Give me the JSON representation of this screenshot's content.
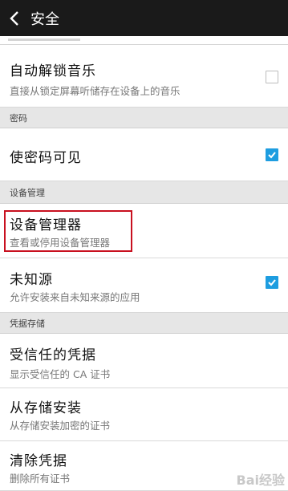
{
  "header": {
    "title": "安全"
  },
  "rows": {
    "auto_unlock_music": {
      "title": "自动解锁音乐",
      "subtitle": "直接从锁定屏幕听储存在设备上的音乐",
      "checked": false
    },
    "show_password": {
      "title": "使密码可见",
      "checked": true
    },
    "device_admins": {
      "title": "设备管理器",
      "subtitle": "查看或停用设备管理器"
    },
    "unknown_sources": {
      "title": "未知源",
      "subtitle": "允许安装来自未知来源的应用",
      "checked": true
    },
    "trusted_credentials": {
      "title": "受信任的凭据",
      "subtitle": "显示受信任的 CA 证书"
    },
    "install_from_storage": {
      "title": "从存储安装",
      "subtitle": "从存储安装加密的证书"
    },
    "clear_credentials": {
      "title": "清除凭据",
      "subtitle": "删除所有证书"
    }
  },
  "sections": {
    "password": "密码",
    "device_admin": "设备管理",
    "credential_storage": "凭据存储"
  },
  "watermark": "Bai经验",
  "colors": {
    "accent": "#1e9de0",
    "highlight": "#c8101f",
    "topbar": "#1a1a1a"
  }
}
